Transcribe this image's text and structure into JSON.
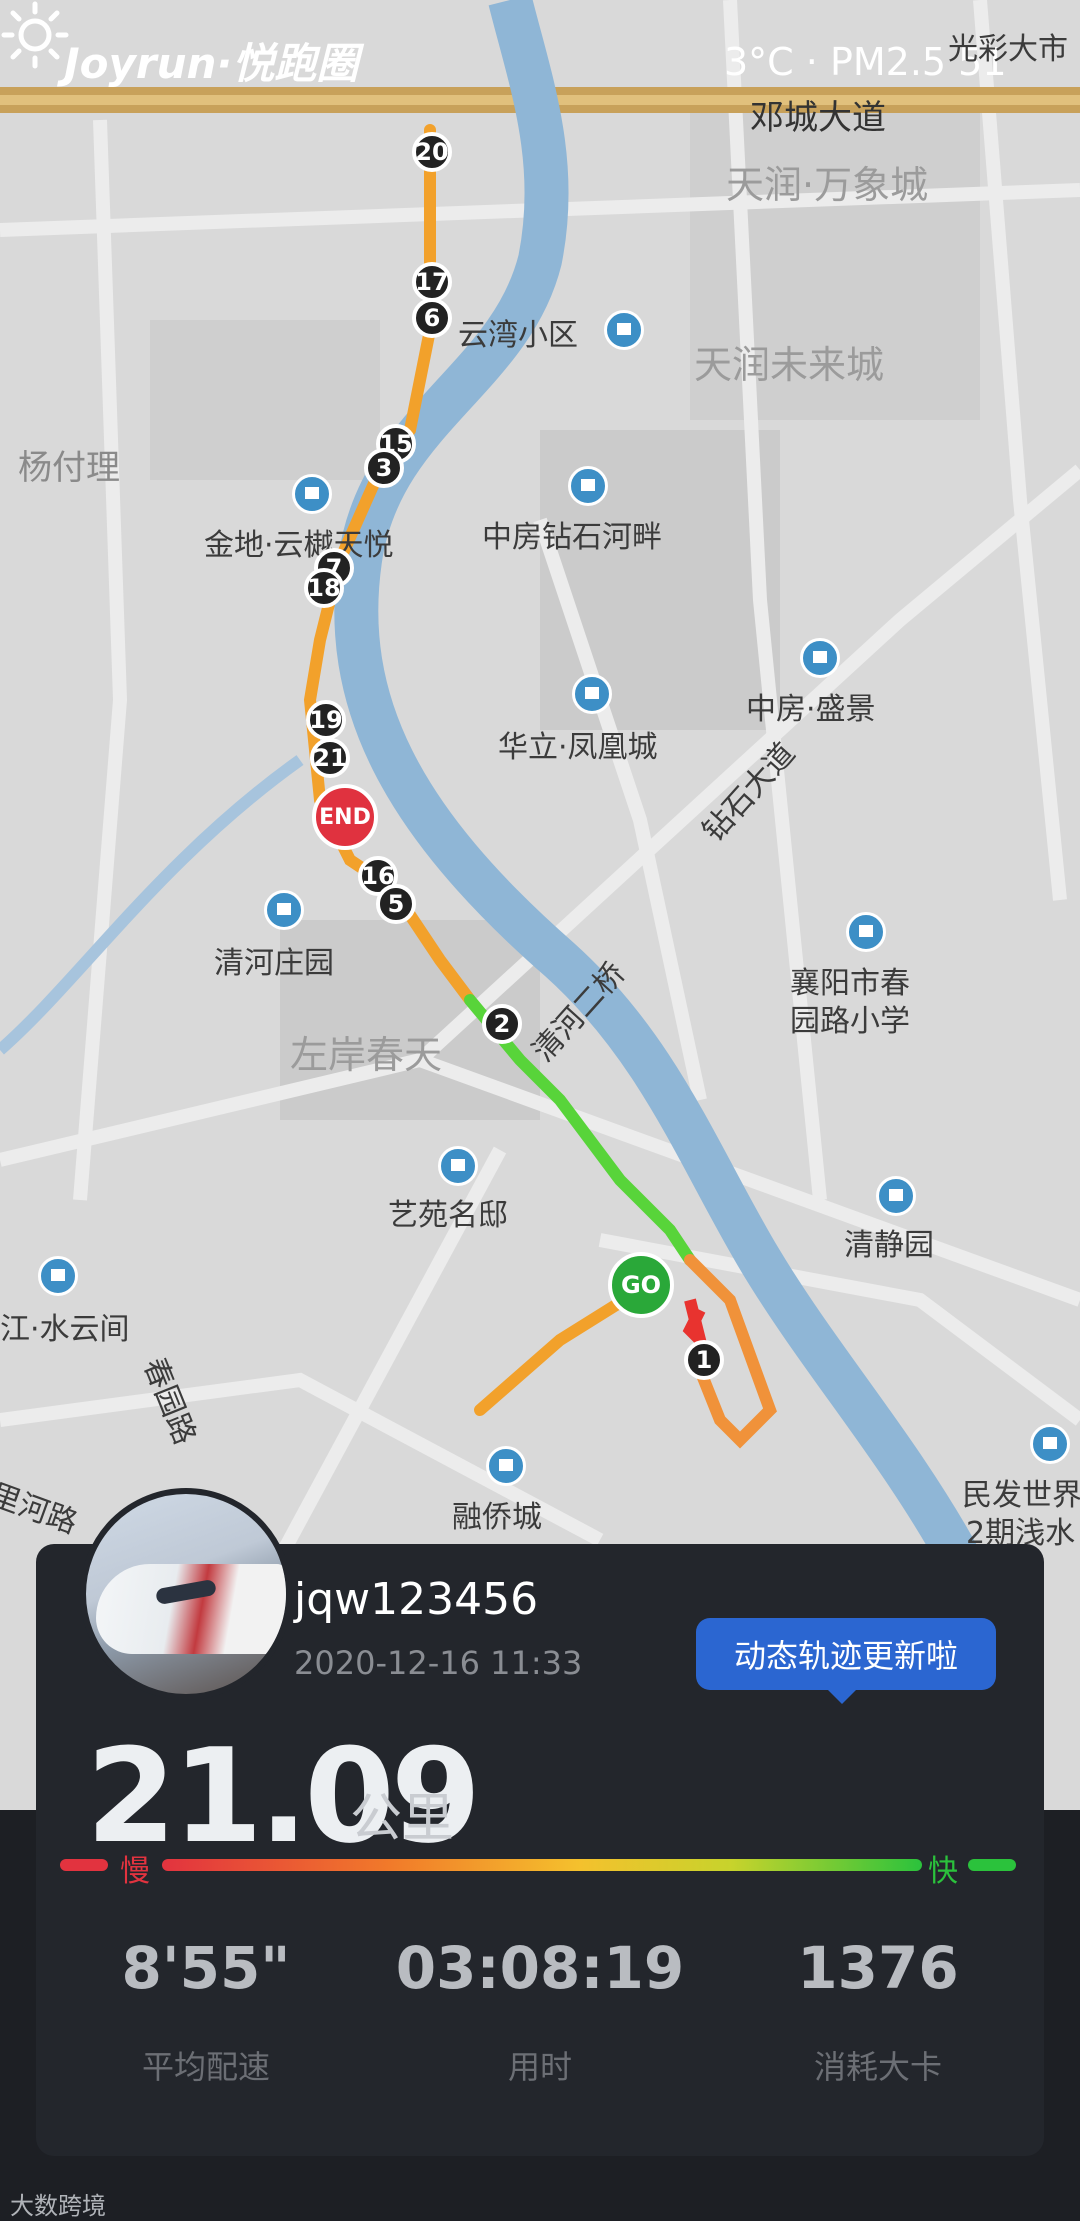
{
  "brand": "Joyrun·悦跑圈",
  "weather": "3°C · PM2.5 51",
  "map": {
    "places": [
      {
        "name": "光彩大市"
      },
      {
        "name": "邓城大道"
      },
      {
        "name": "天润·万象城"
      },
      {
        "name": "云湾小区"
      },
      {
        "name": "天润未来城"
      },
      {
        "name": "杨付理"
      },
      {
        "name": "金地·云樾天悦"
      },
      {
        "name": "中房钻石河畔"
      },
      {
        "name": "中房·盛景"
      },
      {
        "name": "华立·凤凰城"
      },
      {
        "name": "钻石大道"
      },
      {
        "name": "清河庄园"
      },
      {
        "name": "清河二桥"
      },
      {
        "name": "襄阳市春"
      },
      {
        "name": "园路小学"
      },
      {
        "name": "左岸春天"
      },
      {
        "name": "艺苑名邸"
      },
      {
        "name": "清静园"
      },
      {
        "name": "江·水云间"
      },
      {
        "name": "春园路"
      },
      {
        "name": "融侨城"
      },
      {
        "name": "民发世界"
      },
      {
        "name": "2期浅水"
      },
      {
        "name": "里河路"
      }
    ],
    "markers": [
      "20",
      "17",
      "6",
      "15",
      "3",
      "7",
      "18",
      "19",
      "21",
      "16",
      "5",
      "2",
      "1"
    ],
    "end_label": "END",
    "go_label": "GO"
  },
  "user": {
    "name": "jqw123456",
    "date": "2020-12-16 11:33"
  },
  "bubble": "动态轨迹更新啦",
  "distance": {
    "value": "21.09",
    "unit": "公里"
  },
  "pace_scale": {
    "slow": "慢",
    "fast": "快"
  },
  "stats": [
    {
      "value": "8'55\"",
      "label": "平均配速"
    },
    {
      "value": "03:08:19",
      "label": "用时"
    },
    {
      "value": "1376",
      "label": "消耗大卡"
    }
  ],
  "footer": "大数跨境"
}
